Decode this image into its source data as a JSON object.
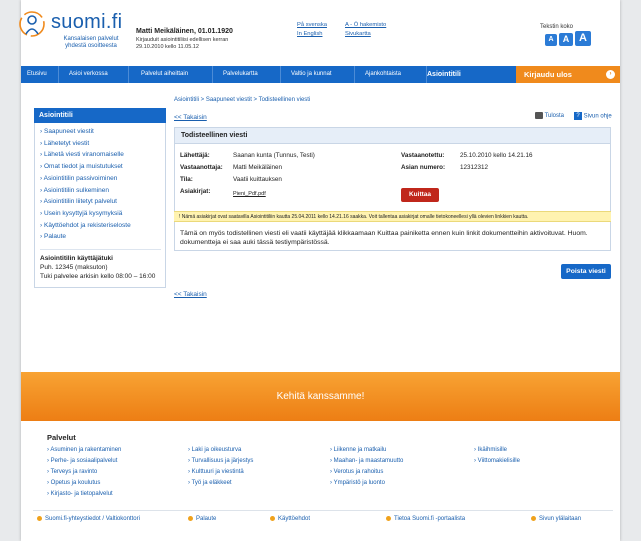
{
  "header": {
    "logo_text": "suomi.fi",
    "logo_sub_1": "Kansalaisen palvelut",
    "logo_sub_2": "yhdestä osoitteesta",
    "user_name": "Matti Meikäläinen, 01.01.1920",
    "user_line1": "Kirjauduit asiointitiliisi edellisen kerran",
    "user_line2": "29.10.2010 kello 11.05.12",
    "lang_sv": "På svenska",
    "lang_en": "In English",
    "az_index": "A - Ö hakemisto",
    "sitemap": "Sivukartta",
    "font_size_label": "Tekstin koko",
    "font_a_small": "A",
    "font_a_medium": "A",
    "font_a_large": "A"
  },
  "nav": {
    "items": [
      "Etusivu",
      "Asioi verkossa",
      "Palvelut aiheittain",
      "Palvelukartta",
      "Valtio ja kunnat",
      "Ajankohtaista",
      "Asiointitili"
    ],
    "logout": "Kirjaudu ulos"
  },
  "sidebar": {
    "title": "Asiointitili",
    "links": [
      "Saapuneet viestit",
      "Lähetetyt viestit",
      "Lähetä viesti viranomaiselle",
      "Omat tiedot ja muistutukset",
      "Asiointitilin passivoiminen",
      "Asiointitilin sulkeminen",
      "Asiointitilin liitetyt palvelut",
      "Usein kysyttyjä kysymyksiä",
      "Käyttöehdot ja rekisteriseloste",
      "Palaute"
    ],
    "support_title": "Asiointitilin käyttäjätuki",
    "support_phone": "Puh. 12345 (maksuton)",
    "support_hours": "Tuki palvelee arkisin kello 08:00 – 16:00"
  },
  "main": {
    "breadcrumb": "Asiointitili > Saapuneet viestit > Todisteellinen viesti",
    "back": "<< Takaisin",
    "print": "Tulosta",
    "help": "Sivun ohje",
    "card_title": "Todisteellinen viesti",
    "sender_label": "Lähettäjä:",
    "sender_value": "Saanan kunta (Tunnus, Testi)",
    "receiver_label": "Vastaanottaja:",
    "receiver_value": "Matti Meikäläinen",
    "state_label": "Tila:",
    "state_value": "Vaatii kuittauksen",
    "docs_label": "Asiakirjat:",
    "docs_value": "Pieni_Pdf.pdf",
    "received_label": "Vastaanotettu:",
    "received_value": "25.10.2010 kello 14.21.16",
    "case_label": "Asian numero:",
    "case_value": "12312312",
    "ack_button": "Kuittaa",
    "notice": "! Nämä asiakirjat ovat saatavilla Asiointitiliin kautta 25.04.2011 kello 14.21.16 saakka. Voit tallentaa asiakirjat omalle tietokoneellesi yllä olevien linkkien kautta.",
    "info": "Tämä on myös todistellinen viesti eli vaatii käyttäjää klikkaamaan Kuittaa painiketta ennen kuin linkit dokumentteihin aktivoituvat. Huom. dokumentteja ei saa auki tässä testiympäristössä.",
    "delete_button": "Poista viesti",
    "back_bottom": "<< Takaisin"
  },
  "banner": {
    "text": "Kehitä kanssamme!"
  },
  "footer": {
    "title": "Palvelut",
    "col1": [
      "Asuminen ja rakentaminen",
      "Perhe- ja sosiaalipalvelut",
      "Terveys ja ravinto",
      "Opetus ja koulutus",
      "Kirjasto- ja tietopalvelut"
    ],
    "col2": [
      "Laki ja oikeusturva",
      "Turvallisuus ja järjestys",
      "Kulttuuri ja viestintä",
      "Työ ja eläkkeet"
    ],
    "col3": [
      "Liikenne ja matkailu",
      "Maahan- ja maastamuutto",
      "Verotus ja rahoitus",
      "Ympäristö ja luonto"
    ],
    "col4": [
      "Ikäihmisille",
      "Viittomakielisille"
    ],
    "bottom": [
      "Suomi.fi-yhteystiedot / Valtiokonttori",
      "Palaute",
      "Käyttöehdot",
      "Tietoa Suomi.fi -portaalista",
      "Sivun ylälaitaan"
    ]
  },
  "colors": {
    "brand_blue": "#1668c7",
    "accent_orange": "#f08a1c",
    "ack_red": "#c0271b",
    "notice_yellow": "#fff3b0"
  }
}
